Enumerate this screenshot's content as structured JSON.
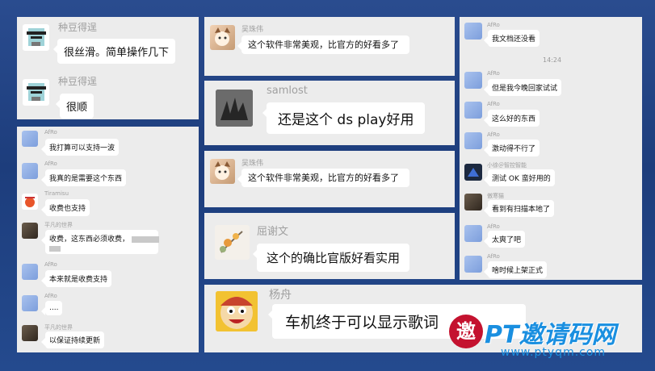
{
  "panel1": {
    "msg1": {
      "sender": "种豆得逞",
      "text": "很丝滑。简单操作几下"
    },
    "msg2": {
      "sender": "种豆得逞",
      "text": "很顺"
    }
  },
  "panel2": {
    "messages": [
      {
        "sender": "AfRo",
        "text": "我打算可以支持一波"
      },
      {
        "sender": "AfRo",
        "text": "我真的是需要这个东西"
      },
      {
        "sender": "Tiramisu",
        "text": "收费也支持"
      },
      {
        "sender": "平凡的世界",
        "text": "收费，这东西必须收费，"
      },
      {
        "sender": "AfRo",
        "text": "本来就是收费支持"
      },
      {
        "sender": "AfRo",
        "text": "...."
      },
      {
        "sender": "平凡的世界",
        "text": "以保证持续更新"
      }
    ]
  },
  "panel3": {
    "sender": "吴珠伟",
    "text": "这个软件非常美观，比官方的好看多了"
  },
  "panel4": {
    "sender": "samlost",
    "text": "还是这个 ds play好用"
  },
  "panel5": {
    "sender": "吴珠伟",
    "text": "这个软件非常美观，比官方的好看多了"
  },
  "panel6": {
    "sender": "屈谢文",
    "text": "这个的确比官版好看实用"
  },
  "panel7": {
    "sender": "杨舟",
    "text": "车机终于可以显示歌词"
  },
  "panel8": {
    "messages": [
      {
        "sender": "AfRo",
        "text": "我文档还没看"
      },
      {
        "sender": "AfRo",
        "text": "但是我今晚回家试试"
      },
      {
        "sender": "AfRo",
        "text": "这么好的东西"
      },
      {
        "sender": "AfRo",
        "text": "激动得不行了"
      },
      {
        "sender": "小徐＠智控智能",
        "text": "测试 OK 蛮好用的"
      },
      {
        "sender": "傲寒猫",
        "text": "看到有扫描本地了"
      },
      {
        "sender": "AfRo",
        "text": "太爽了吧"
      },
      {
        "sender": "AfRo",
        "text": "啥时候上架正式"
      }
    ],
    "time": "14:24"
  },
  "watermark": {
    "text": "PT邀请码网",
    "url": "www.ptyqm.com",
    "badge": "邀"
  },
  "colors": {
    "background": "#244a8e",
    "panel": "#ececec",
    "bubble": "#ffffff",
    "watermark": "#1a8fe0"
  }
}
